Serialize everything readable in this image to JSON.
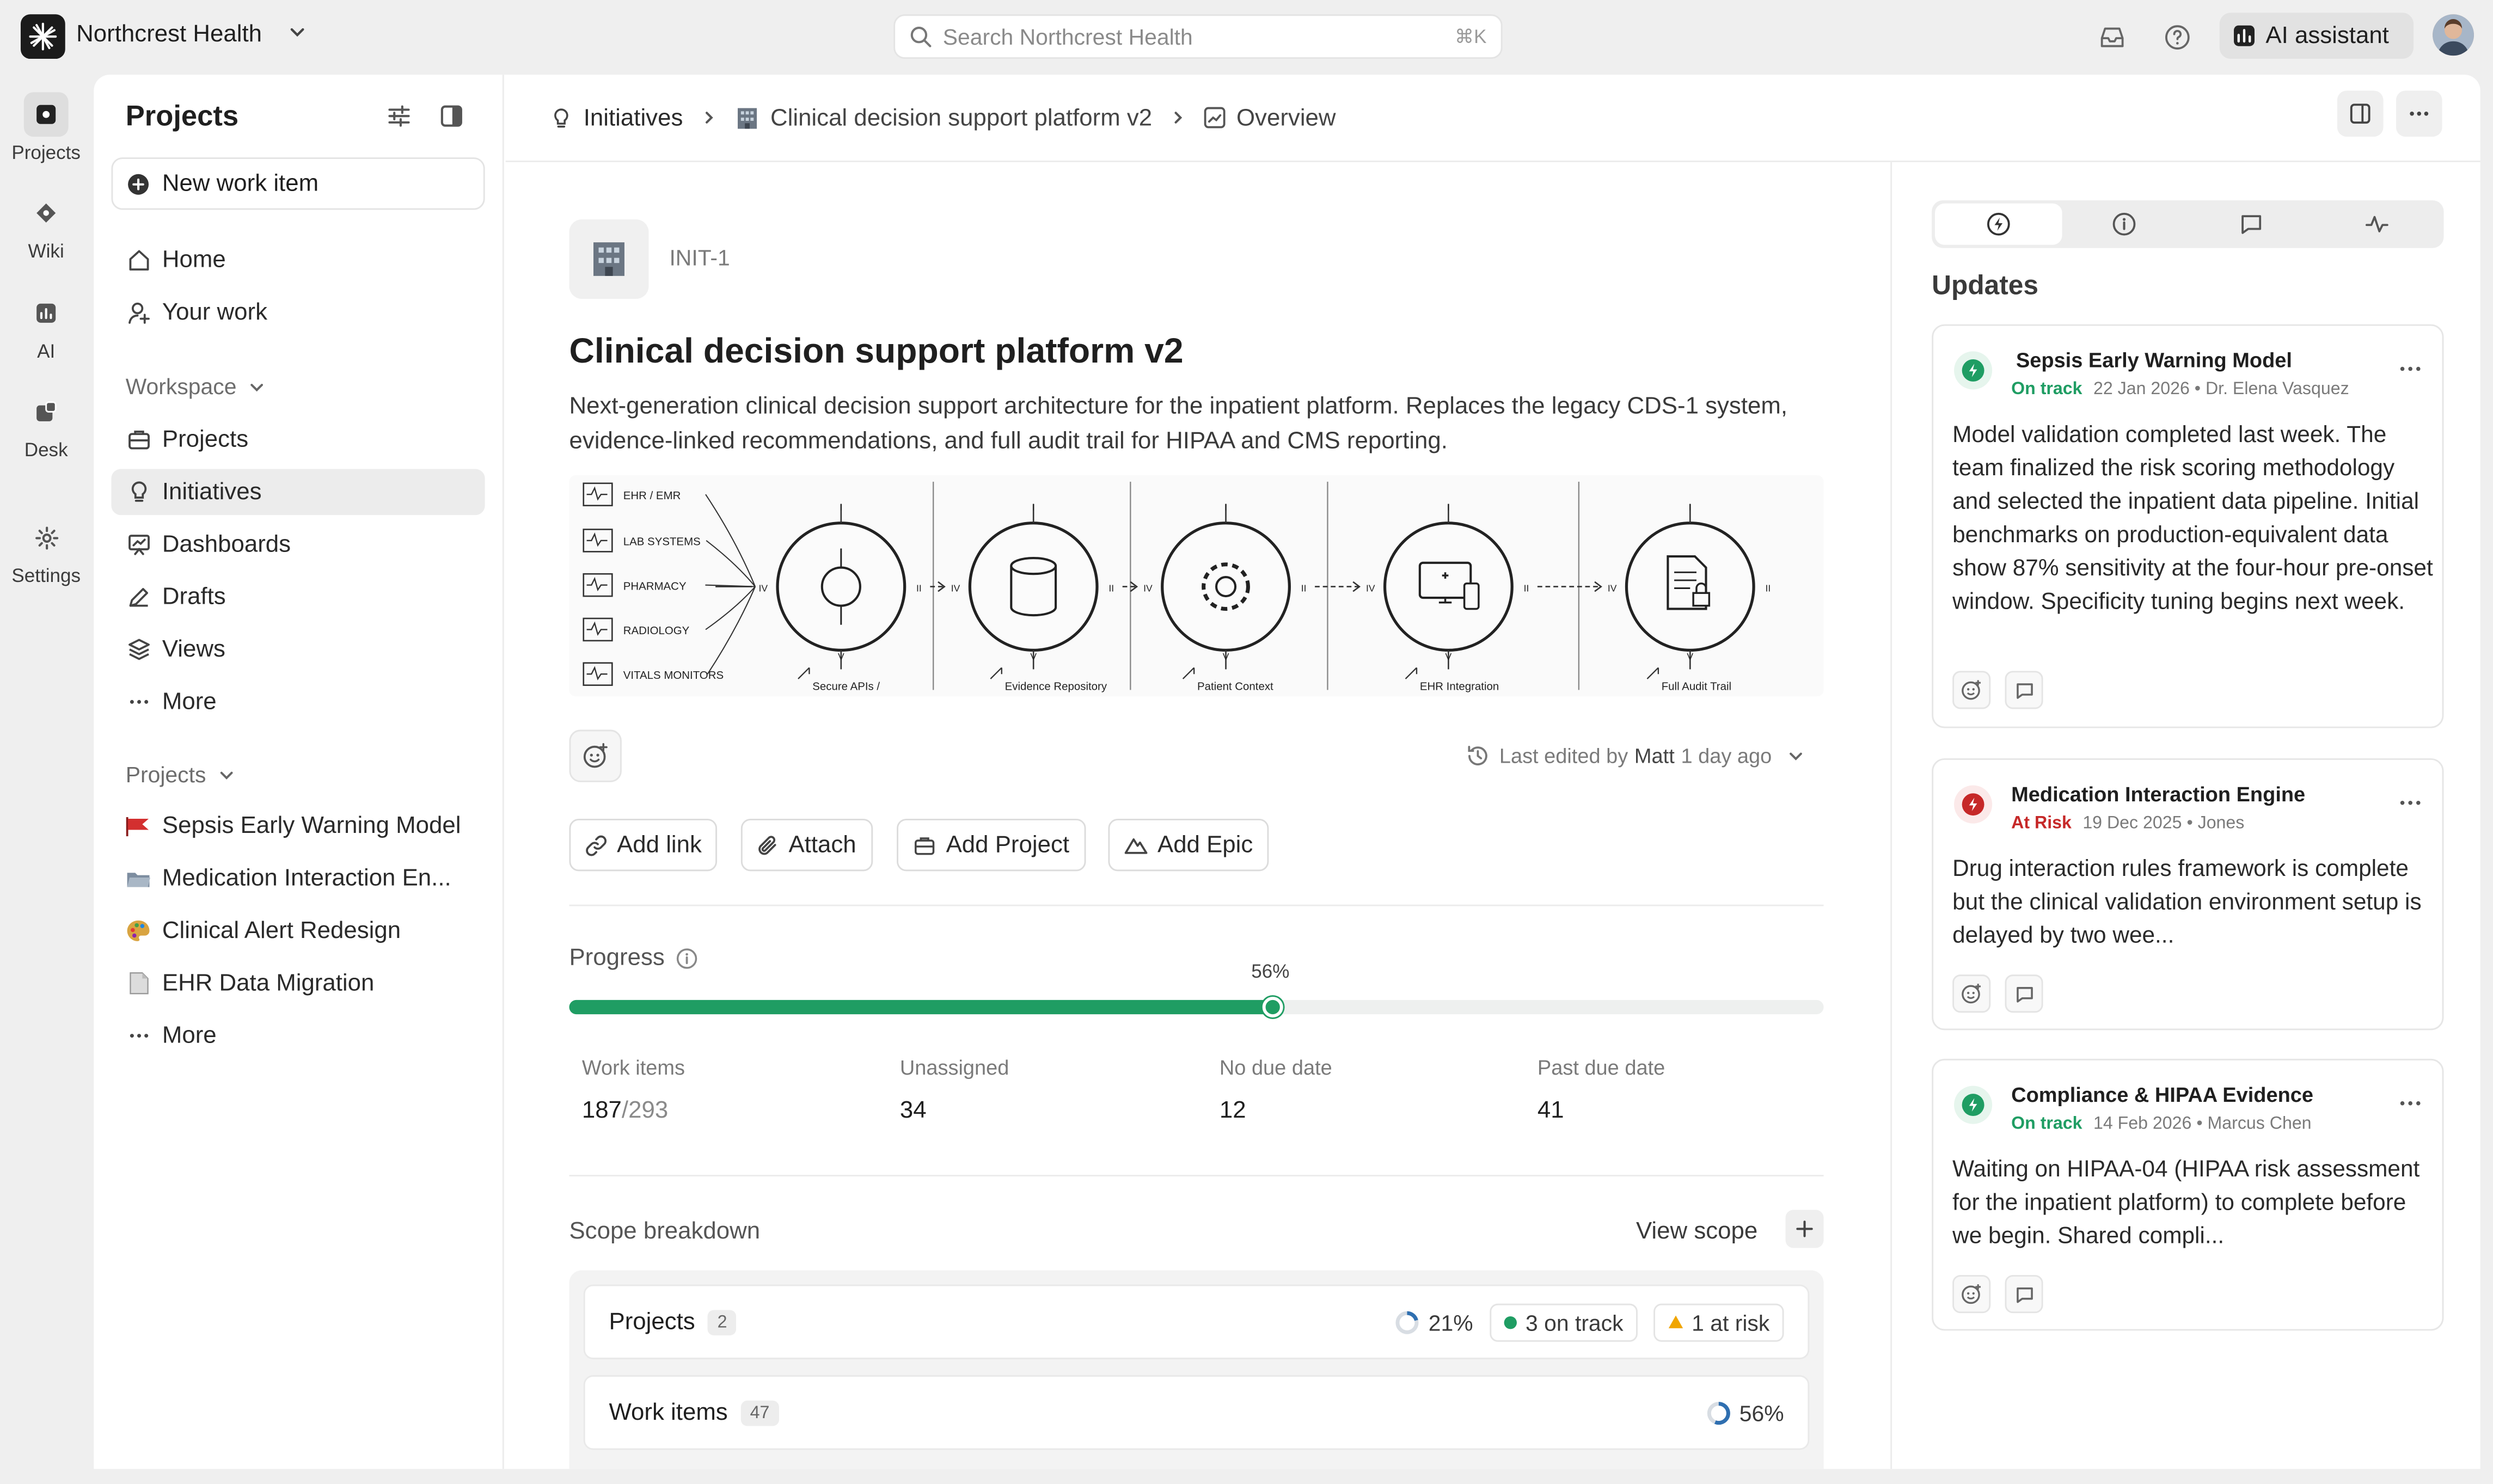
{
  "topbar": {
    "workspace_name": "Northcrest Health",
    "search_placeholder": "Search Northcrest Health",
    "search_shortcut": "⌘K",
    "ai_assistant_label": "AI assistant"
  },
  "rail": {
    "items": [
      {
        "label": "Projects",
        "icon": "projects-icon",
        "active": true
      },
      {
        "label": "Wiki",
        "icon": "wiki-icon"
      },
      {
        "label": "AI",
        "icon": "ai-icon"
      },
      {
        "label": "Desk",
        "icon": "desk-icon"
      },
      {
        "label": "Settings",
        "icon": "settings-icon"
      }
    ]
  },
  "sidebar": {
    "title": "Projects",
    "new_item_label": "New work item",
    "top_nav": [
      {
        "label": "Home",
        "icon": "home-icon"
      },
      {
        "label": "Your work",
        "icon": "user-icon"
      }
    ],
    "workspace_section": "Workspace",
    "workspace_nav": [
      {
        "label": "Projects",
        "icon": "briefcase-icon"
      },
      {
        "label": "Initiatives",
        "icon": "lightbulb-icon",
        "active": true
      },
      {
        "label": "Dashboards",
        "icon": "dashboard-icon"
      },
      {
        "label": "Drafts",
        "icon": "pencil-icon"
      },
      {
        "label": "Views",
        "icon": "layers-icon"
      },
      {
        "label": "More",
        "icon": "ellipsis-icon"
      }
    ],
    "projects_section": "Projects",
    "projects": [
      {
        "label": "Sepsis Early Warning Model",
        "icon": "red-flag-icon"
      },
      {
        "label": "Medication Interaction Engine",
        "display": "Medication Interaction En...",
        "icon": "folder-icon"
      },
      {
        "label": "Clinical Alert Redesign",
        "icon": "palette-icon"
      },
      {
        "label": "EHR Data Migration",
        "icon": "document-icon"
      },
      {
        "label": "More",
        "icon": "ellipsis-icon"
      }
    ]
  },
  "breadcrumb": {
    "items": [
      "Initiatives",
      "Clinical decision support platform v2",
      "Overview"
    ]
  },
  "initiative": {
    "id": "INIT-1",
    "title": "Clinical decision support platform v2",
    "description": "Next-generation clinical decision support architecture for the inpatient platform. Replaces the legacy CDS-1 system, evidence-linked recommendations, and full audit trail for HIPAA and CMS reporting.",
    "diagram": {
      "sources": [
        "EHR / EMR",
        "LAB SYSTEMS",
        "PHARMACY",
        "RADIOLOGY",
        "VITALS MONITORS"
      ],
      "stages": [
        "Secure APIs /",
        "Evidence Repository",
        "Patient Context",
        "EHR Integration",
        "Full Audit Trail"
      ],
      "port_in": "IV",
      "port_out": "II",
      "port_top": "I",
      "port_bottom": "V"
    },
    "last_edited_prefix": "Last edited by",
    "last_edited_by": "Matt",
    "last_edited_when": "1 day ago",
    "actions": [
      "Add link",
      "Attach",
      "Add Project",
      "Add Epic"
    ]
  },
  "progress": {
    "label": "Progress",
    "percent_label": "56%",
    "percent": 56,
    "stats": [
      {
        "label": "Work items",
        "value": "187",
        "total": "/293"
      },
      {
        "label": "Unassigned",
        "value": "34"
      },
      {
        "label": "No due date",
        "value": "12"
      },
      {
        "label": "Past due date",
        "value": "41"
      }
    ]
  },
  "scope": {
    "title": "Scope breakdown",
    "view_label": "View scope",
    "rows": [
      {
        "label": "Projects",
        "count": "2",
        "pct": "21%",
        "pct_value": 21,
        "on_track": "3 on track",
        "at_risk": "1 at risk"
      },
      {
        "label": "Work items",
        "count": "47",
        "pct": "56%",
        "pct_value": 56
      }
    ]
  },
  "updates": {
    "title": "Updates",
    "tabs": [
      "updates-tab-icon",
      "info-tab-icon",
      "comments-tab-icon",
      "activity-tab-icon"
    ],
    "cards": [
      {
        "project": "Sepsis Early Warning Model",
        "status": "On track",
        "status_color": "#1f9d63",
        "date": "22 Jan 2026",
        "author": "• Dr. Elena Vasquez",
        "body": "Model validation completed last week. The team finalized the risk scoring methodology and selected the inpatient data pipeline. Initial benchmarks on production-equivalent data show 87% sensitivity at the four-hour pre-onset window. Specificity tuning begins next week."
      },
      {
        "project": "Medication Interaction Engine",
        "status": "At Risk",
        "status_color": "#c62828",
        "date": "19 Dec 2025",
        "author": "• Jones",
        "body": "Drug interaction rules framework is complete but the clinical validation environment setup is delayed by two wee..."
      },
      {
        "project": "Compliance & HIPAA Evidence",
        "status": "On track",
        "status_color": "#1f9d63",
        "date": "14 Feb 2026",
        "author": "• Marcus Chen",
        "body": "Waiting on HIPAA-04 (HIPAA risk assessment for the inpatient platform) to complete before we begin. Shared compli..."
      }
    ]
  },
  "colors": {
    "accent_green": "#1f9d63",
    "risk_red": "#c62828",
    "warn_amber": "#f0a500"
  }
}
